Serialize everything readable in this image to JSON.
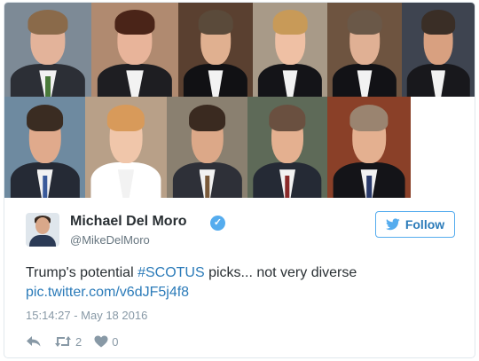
{
  "photos": [
    {
      "name": "portrait-1",
      "bg": "#7d8a96",
      "skin": "#e3b39a",
      "hair": "#8a6a4a",
      "attire": "#2c2f36",
      "tie": "#4a7a3a"
    },
    {
      "name": "portrait-2",
      "bg": "#b08a70",
      "skin": "#e8b49a",
      "hair": "#4a2418",
      "attire": "#1e1e22",
      "tie": ""
    },
    {
      "name": "portrait-3",
      "bg": "#5a4030",
      "skin": "#e0b090",
      "hair": "#5a4a3a",
      "attire": "#111114",
      "tie": ""
    },
    {
      "name": "portrait-4",
      "bg": "#a89a88",
      "skin": "#efc0a4",
      "hair": "#c89a58",
      "attire": "#141418",
      "tie": ""
    },
    {
      "name": "portrait-5",
      "bg": "#6e5440",
      "skin": "#e0b094",
      "hair": "#6a5848",
      "attire": "#121216",
      "tie": ""
    },
    {
      "name": "portrait-6",
      "bg": "#3e4450",
      "skin": "#d8a080",
      "hair": "#3a2e26",
      "attire": "#18181c",
      "tie": ""
    },
    {
      "name": "portrait-7",
      "bg": "#6e8aa0",
      "skin": "#e0aa8c",
      "hair": "#3a2c22",
      "attire": "#252a35",
      "tie": "#3a5a9a"
    },
    {
      "name": "portrait-8",
      "bg": "#b8a088",
      "skin": "#f0c6aa",
      "hair": "#d89a5a",
      "attire": "#ffffff",
      "tie": ""
    },
    {
      "name": "portrait-9",
      "bg": "#8a8070",
      "skin": "#dca888",
      "hair": "#3a2a20",
      "attire": "#2e3038",
      "tie": "#7a5a3a"
    },
    {
      "name": "portrait-10",
      "bg": "#5e6a58",
      "skin": "#e4b090",
      "hair": "#6a5040",
      "attire": "#252a35",
      "tie": "#8a2a2a"
    },
    {
      "name": "portrait-11",
      "bg": "#8a4028",
      "skin": "#e4b090",
      "hair": "#9a8470",
      "attire": "#141418",
      "tie": "#2a3a6a"
    }
  ],
  "tweet": {
    "display_name": "Michael Del Moro",
    "handle": "@MikeDelMoro",
    "verified_mark": "✓",
    "follow_label": "Follow",
    "text_before": "Trump's potential ",
    "hashtag": "#SCOTUS",
    "text_after": " picks... not very diverse",
    "link": "pic.twitter.com/v6dJF5j4f8",
    "timestamp": "15:14:27 - May 18 2016",
    "retweet_count": "2",
    "like_count": "0"
  },
  "colors": {
    "accent": "#55acee",
    "link": "#2b7bb9",
    "text": "#292f33",
    "muted": "#8899a6"
  }
}
